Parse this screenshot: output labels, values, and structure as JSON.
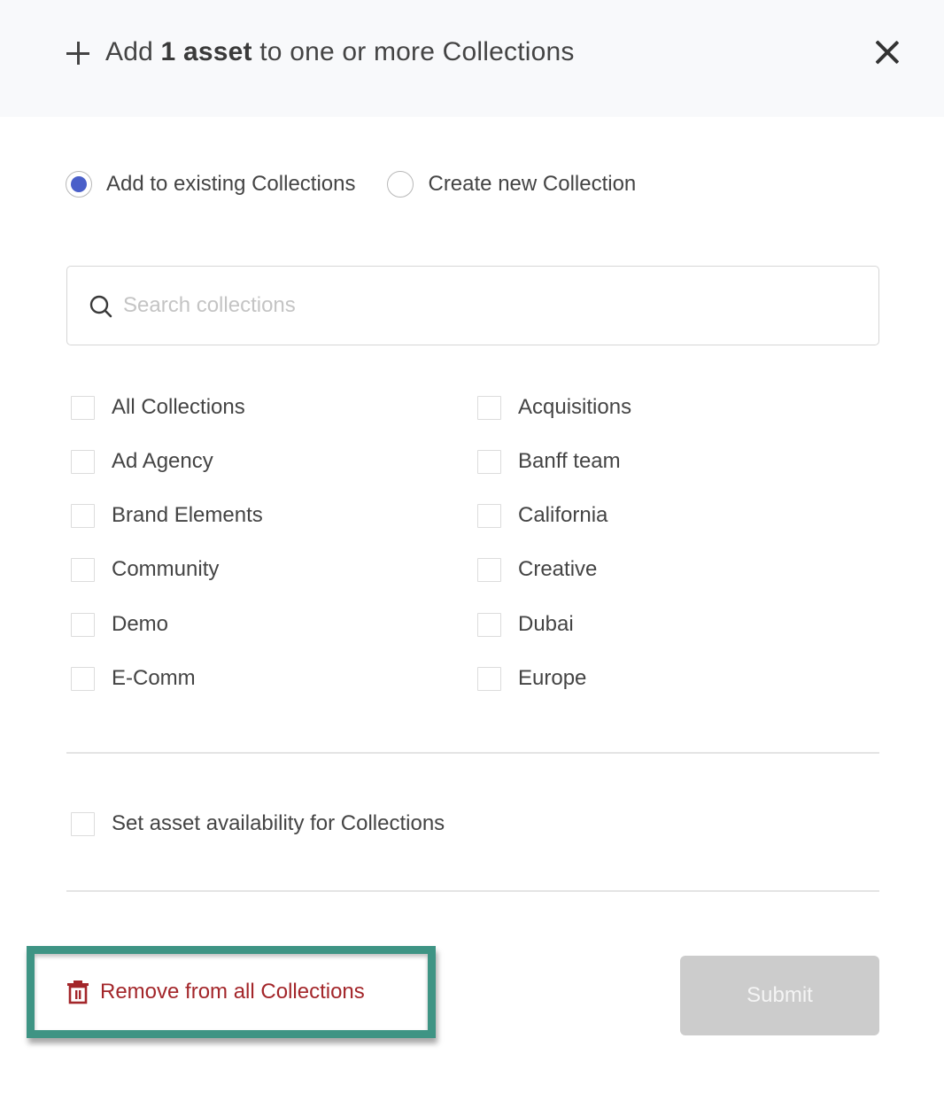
{
  "header": {
    "title_prefix": "Add",
    "title_bold": "1 asset",
    "title_suffix": "to one or more Collections",
    "icon": "plus-icon",
    "close_icon": "close-icon"
  },
  "mode": {
    "options": [
      {
        "label": "Add to existing Collections",
        "selected": true
      },
      {
        "label": "Create new Collection",
        "selected": false
      }
    ]
  },
  "search": {
    "placeholder": "Search collections",
    "value": "",
    "icon": "search-icon"
  },
  "collections": {
    "left": [
      {
        "label": "All Collections",
        "checked": false
      },
      {
        "label": "Ad Agency",
        "checked": false
      },
      {
        "label": "Brand Elements",
        "checked": false
      },
      {
        "label": "Community",
        "checked": false
      },
      {
        "label": "Demo",
        "checked": false
      },
      {
        "label": "E-Comm",
        "checked": false
      }
    ],
    "right": [
      {
        "label": "Acquisitions",
        "checked": false
      },
      {
        "label": "Banff team",
        "checked": false
      },
      {
        "label": "California",
        "checked": false
      },
      {
        "label": "Creative",
        "checked": false
      },
      {
        "label": "Dubai",
        "checked": false
      },
      {
        "label": "Europe",
        "checked": false
      }
    ]
  },
  "availability": {
    "label": "Set asset availability for Collections",
    "checked": false
  },
  "footer": {
    "remove_label": "Remove from all Collections",
    "remove_icon": "trash-icon",
    "submit_label": "Submit",
    "submit_disabled": true
  },
  "colors": {
    "accent": "#4a5fc9",
    "danger": "#a3262a",
    "highlight": "#3e9484",
    "disabled": "#cccccc"
  }
}
